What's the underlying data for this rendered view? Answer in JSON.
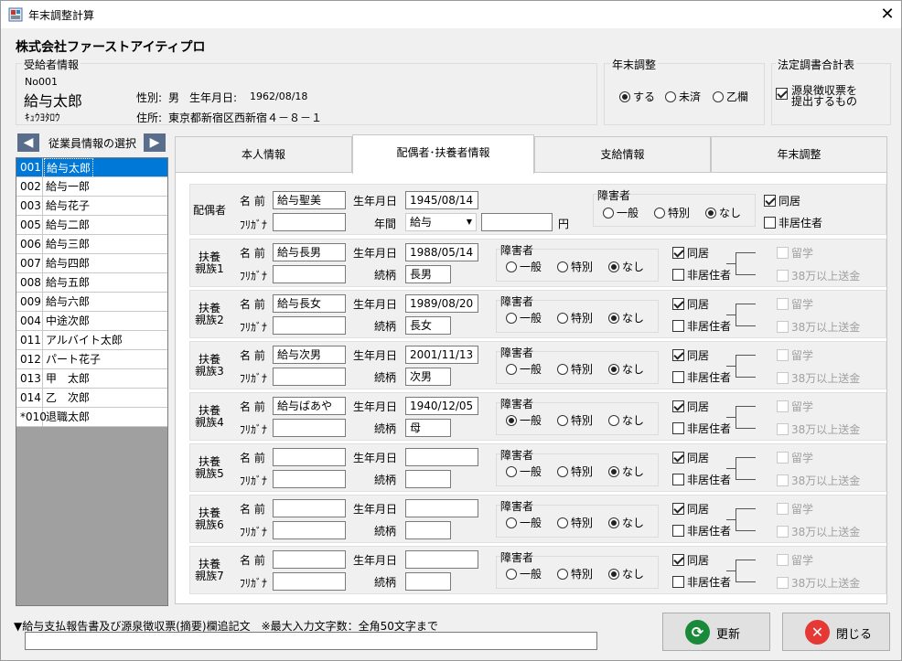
{
  "window": {
    "title": "年末調整計算",
    "close_icon": "close-icon"
  },
  "company": "株式会社ファーストアイティプロ",
  "recipient": {
    "group_label": "受給者情報",
    "no": "No001",
    "name": "給与太郎",
    "kana": "ｷｭｳﾖﾀﾛｳ",
    "gender_label": "性別:",
    "gender": "男",
    "birth_label": "生年月日:",
    "birth": "1962/08/18",
    "address_label": "住所:",
    "address": "東京都新宿区西新宿４－８－１"
  },
  "year_end": {
    "group_label": "年末調整",
    "options": [
      "する",
      "未済",
      "乙欄"
    ],
    "selected": 0
  },
  "legal": {
    "group_label": "法定調書合計表",
    "checkbox_label_1": "源泉徴収票を",
    "checkbox_label_2": "提出するもの",
    "checked": true
  },
  "employee_select": {
    "label": "従業員情報の選択",
    "prev_icon": "arrow-left-icon",
    "next_icon": "arrow-right-icon"
  },
  "employees": [
    {
      "no": "001",
      "name": "給与太郎"
    },
    {
      "no": "002",
      "name": "給与一郎"
    },
    {
      "no": "003",
      "name": "給与花子"
    },
    {
      "no": "005",
      "name": "給与二郎"
    },
    {
      "no": "006",
      "name": "給与三郎"
    },
    {
      "no": "007",
      "name": "給与四郎"
    },
    {
      "no": "008",
      "name": "給与五郎"
    },
    {
      "no": "009",
      "name": "給与六郎"
    },
    {
      "no": "004",
      "name": "中途次郎"
    },
    {
      "no": "011",
      "name": "アルバイト太郎"
    },
    {
      "no": "012",
      "name": "パート花子"
    },
    {
      "no": "013",
      "name": "甲　太郎"
    },
    {
      "no": "014",
      "name": "乙　次郎"
    },
    {
      "no": "*010",
      "name": "退職太郎"
    }
  ],
  "tabs": [
    "本人情報",
    "配偶者･扶養者情報",
    "支給情報",
    "年末調整"
  ],
  "labels": {
    "name": "名 前",
    "furigana": "ﾌﾘｶﾞﾅ",
    "birth": "生年月日",
    "relation": "続柄",
    "annual": "年間",
    "yen": "円",
    "disability": "障害者",
    "general": "一般",
    "special": "特別",
    "none": "なし",
    "cohabit": "同居",
    "nonresident": "非居住者",
    "study": "留学",
    "over380": "38万以上送金"
  },
  "spouse": {
    "label": "配偶者",
    "name": "給与聖美",
    "birth": "1945/08/14",
    "income_type": "給与",
    "income": "",
    "disability": 2,
    "cohabit": true,
    "nonresident": false
  },
  "dependents": [
    {
      "label1": "扶養",
      "label2": "親族1",
      "name": "給与長男",
      "birth": "1988/05/14",
      "relation": "長男",
      "disability": 2,
      "cohabit": true
    },
    {
      "label1": "扶養",
      "label2": "親族2",
      "name": "給与長女",
      "birth": "1989/08/20",
      "relation": "長女",
      "disability": 2,
      "cohabit": true
    },
    {
      "label1": "扶養",
      "label2": "親族3",
      "name": "給与次男",
      "birth": "2001/11/13",
      "relation": "次男",
      "disability": 2,
      "cohabit": true
    },
    {
      "label1": "扶養",
      "label2": "親族4",
      "name": "給与ばあや",
      "birth": "1940/12/05",
      "relation": "母",
      "disability": 0,
      "cohabit": true
    },
    {
      "label1": "扶養",
      "label2": "親族5",
      "name": "",
      "birth": "",
      "relation": "",
      "disability": 2,
      "cohabit": true
    },
    {
      "label1": "扶養",
      "label2": "親族6",
      "name": "",
      "birth": "",
      "relation": "",
      "disability": 2,
      "cohabit": true
    },
    {
      "label1": "扶養",
      "label2": "親族7",
      "name": "",
      "birth": "",
      "relation": "",
      "disability": 2,
      "cohabit": true
    }
  ],
  "footer": {
    "note": "▼給与支払報告書及び源泉徴収票(摘要)欄追記文　※最大入力文字数：全角50文字まで",
    "input": ""
  },
  "buttons": {
    "update": "更新",
    "close": "閉じる",
    "update_icon": "refresh-icon",
    "close_icon": "close-circle-icon"
  },
  "colors": {
    "selection": "#0078d7",
    "update_icon": "#1a8a3a",
    "close_icon": "#e53935"
  }
}
